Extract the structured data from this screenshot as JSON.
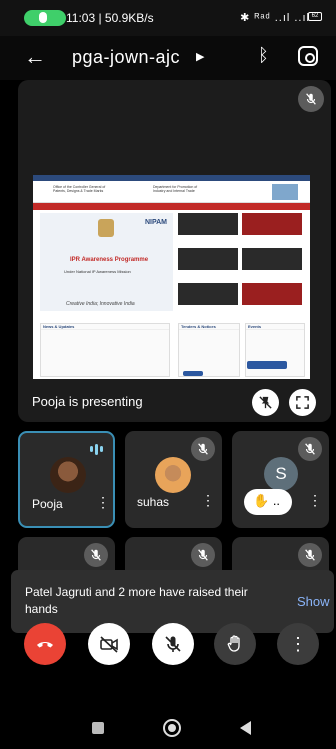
{
  "status_bar": {
    "time_speed": "11:03 | 50.9KB/s",
    "indicators": "✱ ᴿᵃᵈ ..ıl ..ıl",
    "battery": "62"
  },
  "header": {
    "meeting_code": "pga-jown-ajc",
    "back_icon": "arrow-left-icon",
    "bluetooth_icon": "bluetooth-icon",
    "switch_camera_icon": "switch-camera-icon"
  },
  "presentation": {
    "presenter_label": "Pooja is presenting",
    "shared_screen": {
      "slide_title": "IPR Awareness Programme",
      "slide_subtitle": "Under National IP Awareness Mission",
      "slide_tagline": "Creative India; Innovative India",
      "brand": "NIPAM",
      "col1_header": "News & Updates",
      "col2_header": "Tenders & Notices",
      "col3_header": "Events"
    }
  },
  "participants": [
    {
      "name": "Pooja",
      "speaking": true
    },
    {
      "name": "suhas",
      "muted": true
    },
    {
      "initial": "S",
      "muted": true,
      "hand_raised_label": ".."
    }
  ],
  "notification": {
    "text": "Patel Jagruti and 2 more have raised their hands",
    "action": "Show"
  },
  "controls": {
    "end_call_icon": "end-call-icon",
    "camera_icon": "camera-off-icon",
    "mic_icon": "mic-off-icon",
    "raise_hand_icon": "raise-hand-icon",
    "more_icon": "more-options-icon",
    "end_call_color": "#ea4335"
  }
}
